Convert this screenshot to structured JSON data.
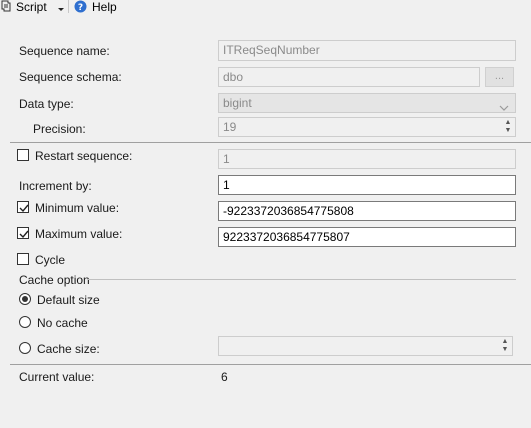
{
  "toolbar": {
    "script_label": "Script",
    "help_label": "Help"
  },
  "form": {
    "sequence_name": {
      "label": "Sequence name:",
      "value": "ITReqSeqNumber"
    },
    "sequence_schema": {
      "label": "Sequence schema:",
      "value": "dbo",
      "browse_label": "..."
    },
    "data_type": {
      "label": "Data type:",
      "value": "bigint"
    },
    "precision": {
      "label": "Precision:",
      "value": "19"
    },
    "restart": {
      "label": "Restart sequence:",
      "value": "1",
      "checked": false
    },
    "increment": {
      "label": "Increment by:",
      "value": "1"
    },
    "minimum": {
      "label": "Minimum value:",
      "value": "-9223372036854775808",
      "checked": true
    },
    "maximum": {
      "label": "Maximum value:",
      "value": "9223372036854775807",
      "checked": true
    },
    "cycle": {
      "label": "Cycle",
      "checked": false
    },
    "cache": {
      "group_label": "Cache option",
      "options": [
        {
          "label": "Default size",
          "selected": true
        },
        {
          "label": "No cache",
          "selected": false
        },
        {
          "label": "Cache size:",
          "selected": false
        }
      ],
      "size_value": ""
    },
    "current_value": {
      "label": "Current value:",
      "value": "6"
    }
  }
}
